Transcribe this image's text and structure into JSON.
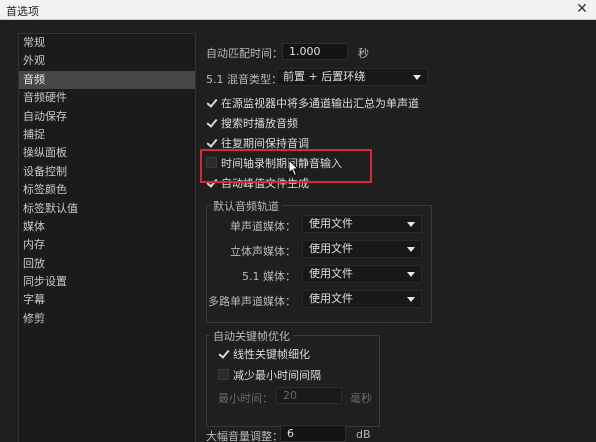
{
  "window": {
    "title": "首选项",
    "close_glyph": "✕"
  },
  "sidebar": {
    "items": [
      {
        "label": "常规"
      },
      {
        "label": "外观"
      },
      {
        "label": "音频",
        "selected": true
      },
      {
        "label": "音频硬件"
      },
      {
        "label": "自动保存"
      },
      {
        "label": "捕捉"
      },
      {
        "label": "操纵面板"
      },
      {
        "label": "设备控制"
      },
      {
        "label": "标签颜色"
      },
      {
        "label": "标签默认值"
      },
      {
        "label": "媒体"
      },
      {
        "label": "内存"
      },
      {
        "label": "回放"
      },
      {
        "label": "同步设置"
      },
      {
        "label": "字幕"
      },
      {
        "label": "修剪"
      }
    ]
  },
  "audio": {
    "auto_match_label": "自动匹配时间：",
    "auto_match_value": "1.000",
    "auto_match_unit": "秒",
    "mix_type_label": "5.1 混音类型：",
    "mix_type_value": "前置 + 后置环绕",
    "checkboxes": [
      {
        "label": "在源监视器中将多通道输出汇总为单声道",
        "checked": true
      },
      {
        "label": "搜索时播放音频",
        "checked": true
      },
      {
        "label": "往复期间保持音调",
        "checked": true
      },
      {
        "label": "时间轴录制期间静音输入",
        "checked": false
      },
      {
        "label": "自动峰值文件生成",
        "checked": true
      }
    ],
    "default_tracks": {
      "title": "默认音频轨道",
      "rows": [
        {
          "label": "单声道媒体：",
          "value": "使用文件"
        },
        {
          "label": "立体声媒体：",
          "value": "使用文件"
        },
        {
          "label": "5.1 媒体：",
          "value": "使用文件"
        },
        {
          "label": "多路单声道媒体：",
          "value": "使用文件"
        }
      ]
    },
    "keyframe": {
      "title": "自动关键帧优化",
      "linear_label": "线性关键帧细化",
      "linear_checked": true,
      "min_interval_label": "减少最小时间间隔",
      "min_interval_checked": false,
      "min_time_label": "最小时间：",
      "min_time_value": "20",
      "min_time_unit": "毫秒"
    },
    "gain_label": "大幅音量调整：",
    "gain_value": "6",
    "gain_unit": "dB"
  },
  "colors": {
    "highlight": "#d9282f",
    "selected_bg": "#474747"
  }
}
